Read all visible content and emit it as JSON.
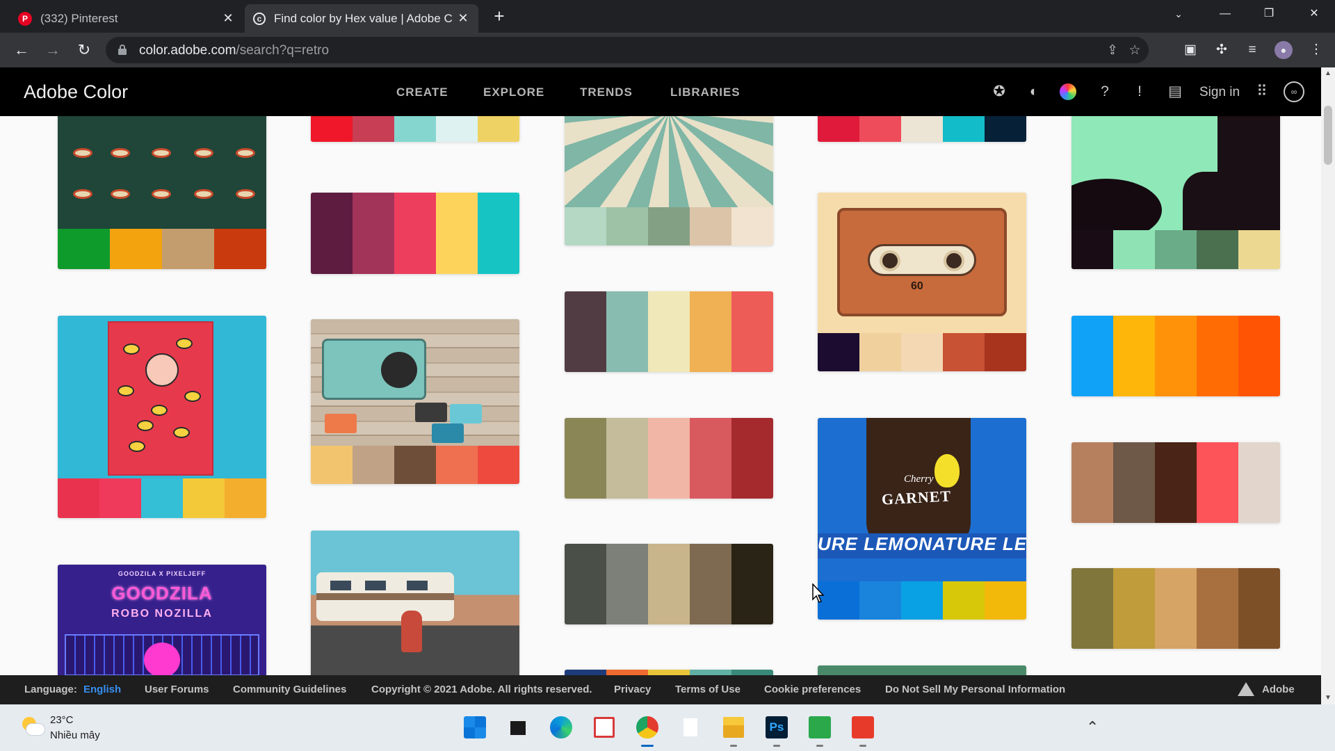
{
  "browser": {
    "tabs": [
      {
        "title": "(332) Pinterest",
        "favicon": "pinterest-icon",
        "active": false
      },
      {
        "title": "Find color by Hex value | Adobe C",
        "favicon": "adobe-color-icon",
        "active": true
      }
    ],
    "new_tab_label": "+",
    "address": {
      "host": "color.adobe.com",
      "path": "/search?q=retro"
    }
  },
  "app": {
    "brand": "Adobe Color",
    "nav": [
      "CREATE",
      "EXPLORE",
      "TRENDS",
      "LIBRARIES"
    ],
    "sign_in": "Sign in"
  },
  "themes": {
    "col1": [
      {
        "swatches": [
          "#0f9a2c",
          "#f2a30e",
          "#c49d6e",
          "#c93a0e"
        ],
        "image": "food"
      },
      {
        "swatches": [
          "#e9334e",
          "#ef3a5c",
          "#34bfd6",
          "#f3c93a",
          "#f4ae2e"
        ],
        "image": "lemon-poster"
      },
      {
        "swatches": [],
        "image": "godzila",
        "poster_lines": [
          "GOODZILA X PIXELJEFF",
          "GOODZILA",
          "ROBO NOZILLA"
        ]
      }
    ],
    "col2": [
      {
        "swatches": [
          "#ef1729",
          "#c83e54",
          "#86d6d0",
          "#def3f1",
          "#efd264"
        ]
      },
      {
        "swatches": [
          "#5d1c40",
          "#a2345a",
          "#ee3e5e",
          "#fed35c",
          "#16c4c4"
        ]
      },
      {
        "swatches": [
          "#f3c46e",
          "#c0a286",
          "#6e4e38",
          "#ee7050",
          "#ee4a3e"
        ],
        "image": "boombox"
      },
      {
        "swatches": [],
        "image": "rv-skater"
      }
    ],
    "col3": [
      {
        "swatches": [
          "#b4d8c4",
          "#9ec2a6",
          "#84a084",
          "#dcc4a8",
          "#f2e2d0"
        ],
        "image": "swirl"
      },
      {
        "swatches": [
          "#523c44",
          "#88bcb0",
          "#f0e8b8",
          "#f0b054",
          "#ee5c58"
        ]
      },
      {
        "swatches": [
          "#8a8656",
          "#c4bc9a",
          "#f2b6a6",
          "#d85a5e",
          "#a42a2e"
        ]
      },
      {
        "swatches": [
          "#4a5048",
          "#7c8078",
          "#c9b58c",
          "#7e6a50",
          "#2a2416"
        ]
      },
      {
        "swatches": [
          "#1e3c7a",
          "#ee6a2e",
          "#e8c43a",
          "#60b0a4",
          "#3a8a7a"
        ]
      }
    ],
    "col4": [
      {
        "swatches": [
          "#e01a3a",
          "#ee4c5a",
          "#ece4d4",
          "#12bcc8",
          "#062038"
        ]
      },
      {
        "swatches": [
          "#1c0c30",
          "#f0d09c",
          "#f4d8b4",
          "#c85234",
          "#a8341e"
        ],
        "image": "cassette",
        "cassette_label": "60"
      },
      {
        "swatches": [
          "#0a70d8",
          "#1a84dc",
          "#0aa0e4",
          "#d8c80a",
          "#f2b80a"
        ],
        "image": "garnet",
        "poster_lines": [
          "Cherry",
          "GARNET",
          "URE LEMONATURE LEI"
        ]
      },
      {
        "swatches": [
          "#4a8a6a"
        ]
      }
    ],
    "col5": [
      {
        "swatches": [
          "#1a0c14",
          "#8ee2b4",
          "#6aac88",
          "#4a7050",
          "#ecd890"
        ],
        "image": "dj"
      },
      {
        "swatches": [
          "#10a2f6",
          "#ffb60a",
          "#ff9208",
          "#ff6c04",
          "#fe5404"
        ]
      },
      {
        "swatches": [
          "#b6805e",
          "#6e5848",
          "#4a2416",
          "#fd545a",
          "#e2d6cc"
        ]
      },
      {
        "swatches": [
          "#80763c",
          "#c09c3a",
          "#d6a464",
          "#a8703e",
          "#7e5028"
        ]
      }
    ]
  },
  "footer": {
    "language_label": "Language:",
    "language_value": "English",
    "links": [
      "User Forums",
      "Community Guidelines",
      "Copyright © 2021 Adobe. All rights reserved.",
      "Privacy",
      "Terms of Use",
      "Cookie preferences",
      "Do Not Sell My Personal Information"
    ],
    "brand": "Adobe"
  },
  "taskbar": {
    "temperature": "23°C",
    "condition": "Nhiều mây",
    "apps": [
      "start",
      "task-view",
      "edge",
      "snipping-tool",
      "chrome",
      "notepad",
      "file-explorer",
      "photoshop",
      "camtasia",
      "camtasia-recorder"
    ]
  }
}
